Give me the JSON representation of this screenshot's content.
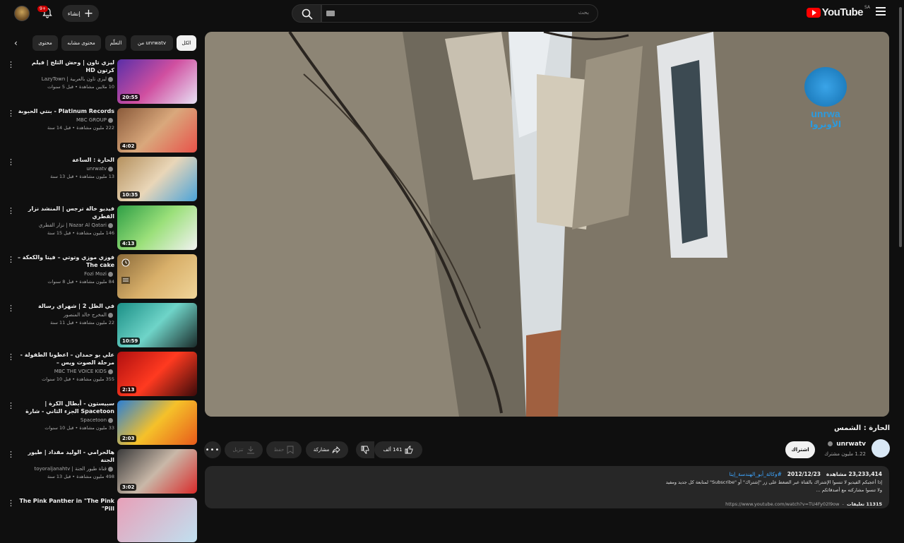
{
  "header": {
    "brand": "YouTube",
    "region": "SA",
    "search_placeholder": "بحث",
    "create_label": "إنشاء",
    "notif_count": "9+"
  },
  "chips": [
    "الكل",
    "من unrwatv",
    "التعلّم",
    "محتوى مشابه",
    "محتوى"
  ],
  "videos": [
    {
      "title": "ليزي تاون | وحش الثلج | فيلم كرتون HD",
      "channel": "ليزي تاون بالعربية | LazyTown",
      "stats": "10 ملايين مشاهدة • قبل 5 سنوات",
      "duration": "20:55"
    },
    {
      "title": "Platinum Records - بنتي الحبوبة",
      "channel": "MBC GROUP",
      "stats": "222 مليون مشاهدة • قبل 14 سنة",
      "duration": "4:02"
    },
    {
      "title": "الحارة : الساعة",
      "channel": "unrwatv",
      "stats": "13 مليون مشاهدة • قبل 13 سنة",
      "duration": "10:35"
    },
    {
      "title": "فيديو خالة ترجس | المنشد نزار القطري",
      "channel": "Nazar Al Qatari | نزار القطري",
      "stats": "146 مليون مشاهدة • قبل 15 سنة",
      "duration": "4:13"
    },
    {
      "title": "فوزي موزي وتوتي – فيتا والكعكة – The cake",
      "channel": "Fozi Mozi",
      "stats": "84 مليون مشاهدة • قبل 8 سنوات",
      "duration": ""
    },
    {
      "title": "في الظل 2 | شهراي رسالة",
      "channel": "المخرج خالد المنصور",
      "stats": "22 مليون مشاهدة • قبل 11 سنة",
      "duration": "10:59"
    },
    {
      "title": "علي بو حمدان – اعطونا الطفولة - مرحلة الصوت ويس – MBCTheVoiceKids",
      "channel": "MBC THE VOICE KIDS",
      "stats": "355 مليون مشاهدة • قبل 10 سنوات",
      "duration": "2:13"
    },
    {
      "title": "سبيستون - أبطال الكرة | Spacetoon الجزء الثاني - شارة العمل",
      "channel": "Spacetoon",
      "stats": "33 مليون مشاهدة • قبل 10 سنوات",
      "duration": "2:03"
    },
    {
      "title": "هالحرامي - الوليد مقداد | طيور الجنة",
      "channel": "قناة طيور الجنة | toyoraljanahtv",
      "stats": "498 مليون مشاهدة • قبل 13 سنة",
      "duration": "3:02"
    },
    {
      "title": "The Pink Panther in \"The Pink Pill\"",
      "channel": "",
      "stats": "",
      "duration": ""
    }
  ],
  "watermark": {
    "latin": "unrwa",
    "arabic": "الأونروا"
  },
  "video": {
    "title": "الحارة : الشمس",
    "channel": "unrwatv",
    "subscribers": "1.22 مليون مشترك",
    "subscribe_label": "اشتراك",
    "likes": "141 ألف",
    "share_label": "مشاركة",
    "save_label": "حفظ",
    "download_label": "تنزيل",
    "views": "23,233,414 مشاهدة",
    "date": "2012/12/23",
    "hashtag": "#وكالة_أبو_الهندسة_إيتا",
    "desc_line1": "إذا أعجبكم الفيديو لا تنسوا الإشتراك بالقناة عبر الضغط على زر \"إشتراك\" أو \"Subscribe\" لمتابعة كل جديد ومفيد",
    "desc_line2": "ولا تنسوا مشاركته مع أصدقائكم ...",
    "link": "https://www.youtube.com/watch?v=TU4Fy02l9ow",
    "comments": "11315 تعليقات"
  }
}
